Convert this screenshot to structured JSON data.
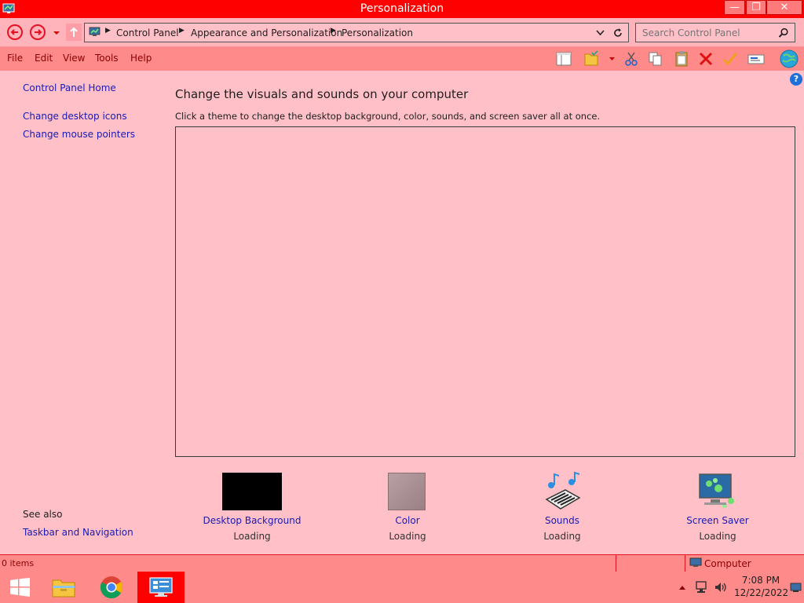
{
  "window": {
    "title": "Personalization",
    "min_glyph": "—",
    "max_glyph": "❐",
    "close_glyph": "✕"
  },
  "nav": {
    "breadcrumbs": [
      "Control Panel",
      "Appearance and Personalization",
      "Personalization"
    ],
    "search_placeholder": "Search Control Panel"
  },
  "menu": {
    "items": [
      "File",
      "Edit",
      "View",
      "Tools",
      "Help"
    ]
  },
  "sidebar": {
    "home": "Control Panel Home",
    "links": [
      "Change desktop icons",
      "Change mouse pointers"
    ],
    "see_also_title": "See also",
    "see_also_links": [
      "Taskbar and Navigation"
    ]
  },
  "main": {
    "heading": "Change the visuals and sounds on your computer",
    "subtext": "Click a theme to change the desktop background, color, sounds, and screen saver all at once."
  },
  "tiles": [
    {
      "label": "Desktop Background",
      "status": "Loading",
      "icon": "desktop-background-thumbnail"
    },
    {
      "label": "Color",
      "status": "Loading",
      "icon": "color-swatch"
    },
    {
      "label": "Sounds",
      "status": "Loading",
      "icon": "sounds-icon"
    },
    {
      "label": "Screen Saver",
      "status": "Loading",
      "icon": "screen-saver-icon"
    }
  ],
  "statusbar": {
    "items_text": "0 items",
    "location": "Computer"
  },
  "taskbar": {
    "time": "7:08 PM",
    "date": "12/22/2022"
  },
  "colors": {
    "accent": "#ff0000",
    "background": "#ffc0c8",
    "link": "#1a1ab4"
  }
}
